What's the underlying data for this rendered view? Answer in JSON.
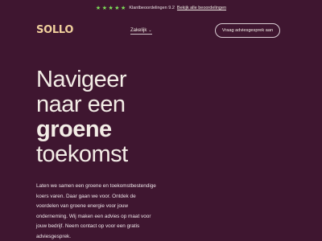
{
  "ratings": {
    "stars": [
      "★",
      "★",
      "★",
      "★",
      "★"
    ],
    "star_color": "#7ee05a",
    "text": "Klantbeoordelingen 9.2",
    "link": "Bekijk alle beoordelingen"
  },
  "header": {
    "logo": "SOLLO",
    "nav": {
      "label": "Zakelijk",
      "chevron": "⌄"
    },
    "cta": "Vraag adviesgesprek aan"
  },
  "hero": {
    "title_lines": [
      "Navigeer",
      "naar een",
      "groene",
      "toekomst"
    ],
    "body": "Laten we samen een groene en toekomstbestendige koers varen. Daar gaan we voor. Ontdek de voordelen van groene energie voor jouw onderneming. Wij maken een advies op maat voor jouw bedrijf. Neem contact op voor een gratis adviesgesprek."
  },
  "colors": {
    "background": "#3f1630",
    "logo": "#f0cf9c",
    "text": "#f3ede6"
  }
}
